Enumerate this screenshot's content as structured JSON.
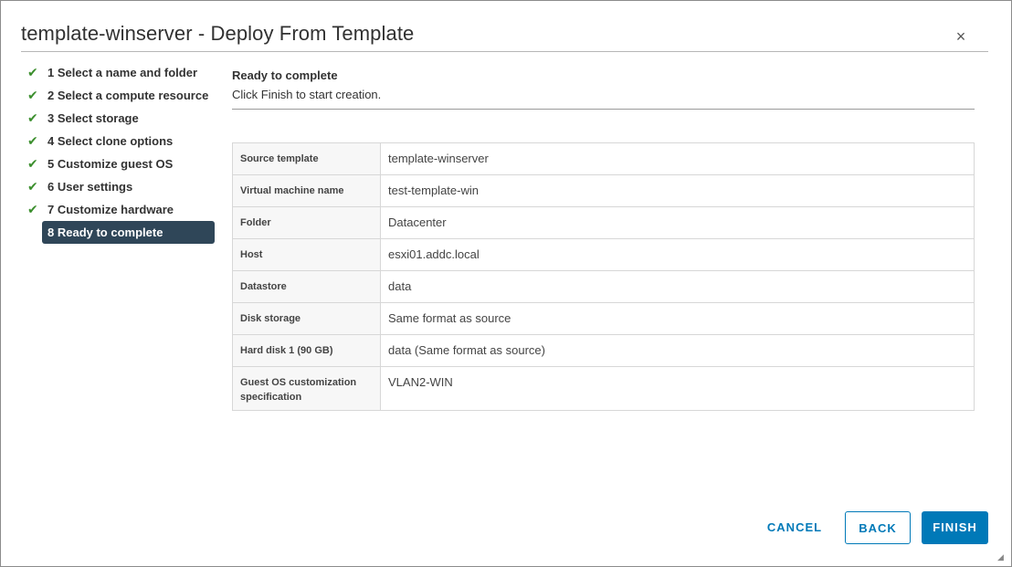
{
  "dialog": {
    "title": "template-winserver - Deploy From Template",
    "close_glyph": "×"
  },
  "steps": [
    {
      "label": "1 Select a name and folder",
      "done": true
    },
    {
      "label": "2 Select a compute resource",
      "done": true
    },
    {
      "label": "3 Select storage",
      "done": true
    },
    {
      "label": "4 Select clone options",
      "done": true
    },
    {
      "label": "5 Customize guest OS",
      "done": true
    },
    {
      "label": "6 User settings",
      "done": true
    },
    {
      "label": "7 Customize hardware",
      "done": true
    },
    {
      "label": "8 Ready to complete",
      "done": false,
      "active": true
    }
  ],
  "content": {
    "title": "Ready to complete",
    "description": "Click Finish to start creation."
  },
  "summary": [
    {
      "key": "Source template",
      "value": "template-winserver"
    },
    {
      "key": "Virtual machine name",
      "value": "test-template-win"
    },
    {
      "key": "Folder",
      "value": "Datacenter"
    },
    {
      "key": "Host",
      "value": "esxi01.addc.local"
    },
    {
      "key": "Datastore",
      "value": "data"
    },
    {
      "key": "Disk storage",
      "value": "Same format as source"
    },
    {
      "key": "Hard disk 1 (90 GB)",
      "value": "data (Same format as source)"
    },
    {
      "key": "Guest OS customization specification",
      "value": "VLAN2-WIN"
    }
  ],
  "buttons": {
    "cancel": "CANCEL",
    "back": "BACK",
    "finish": "FINISH"
  },
  "icons": {
    "check": "checkmark-icon",
    "close": "close-icon",
    "resize": "resize-grip-icon"
  },
  "colors": {
    "accent": "#0079b8",
    "active_step_bg": "#2f4658",
    "check": "#3c8f2e"
  }
}
